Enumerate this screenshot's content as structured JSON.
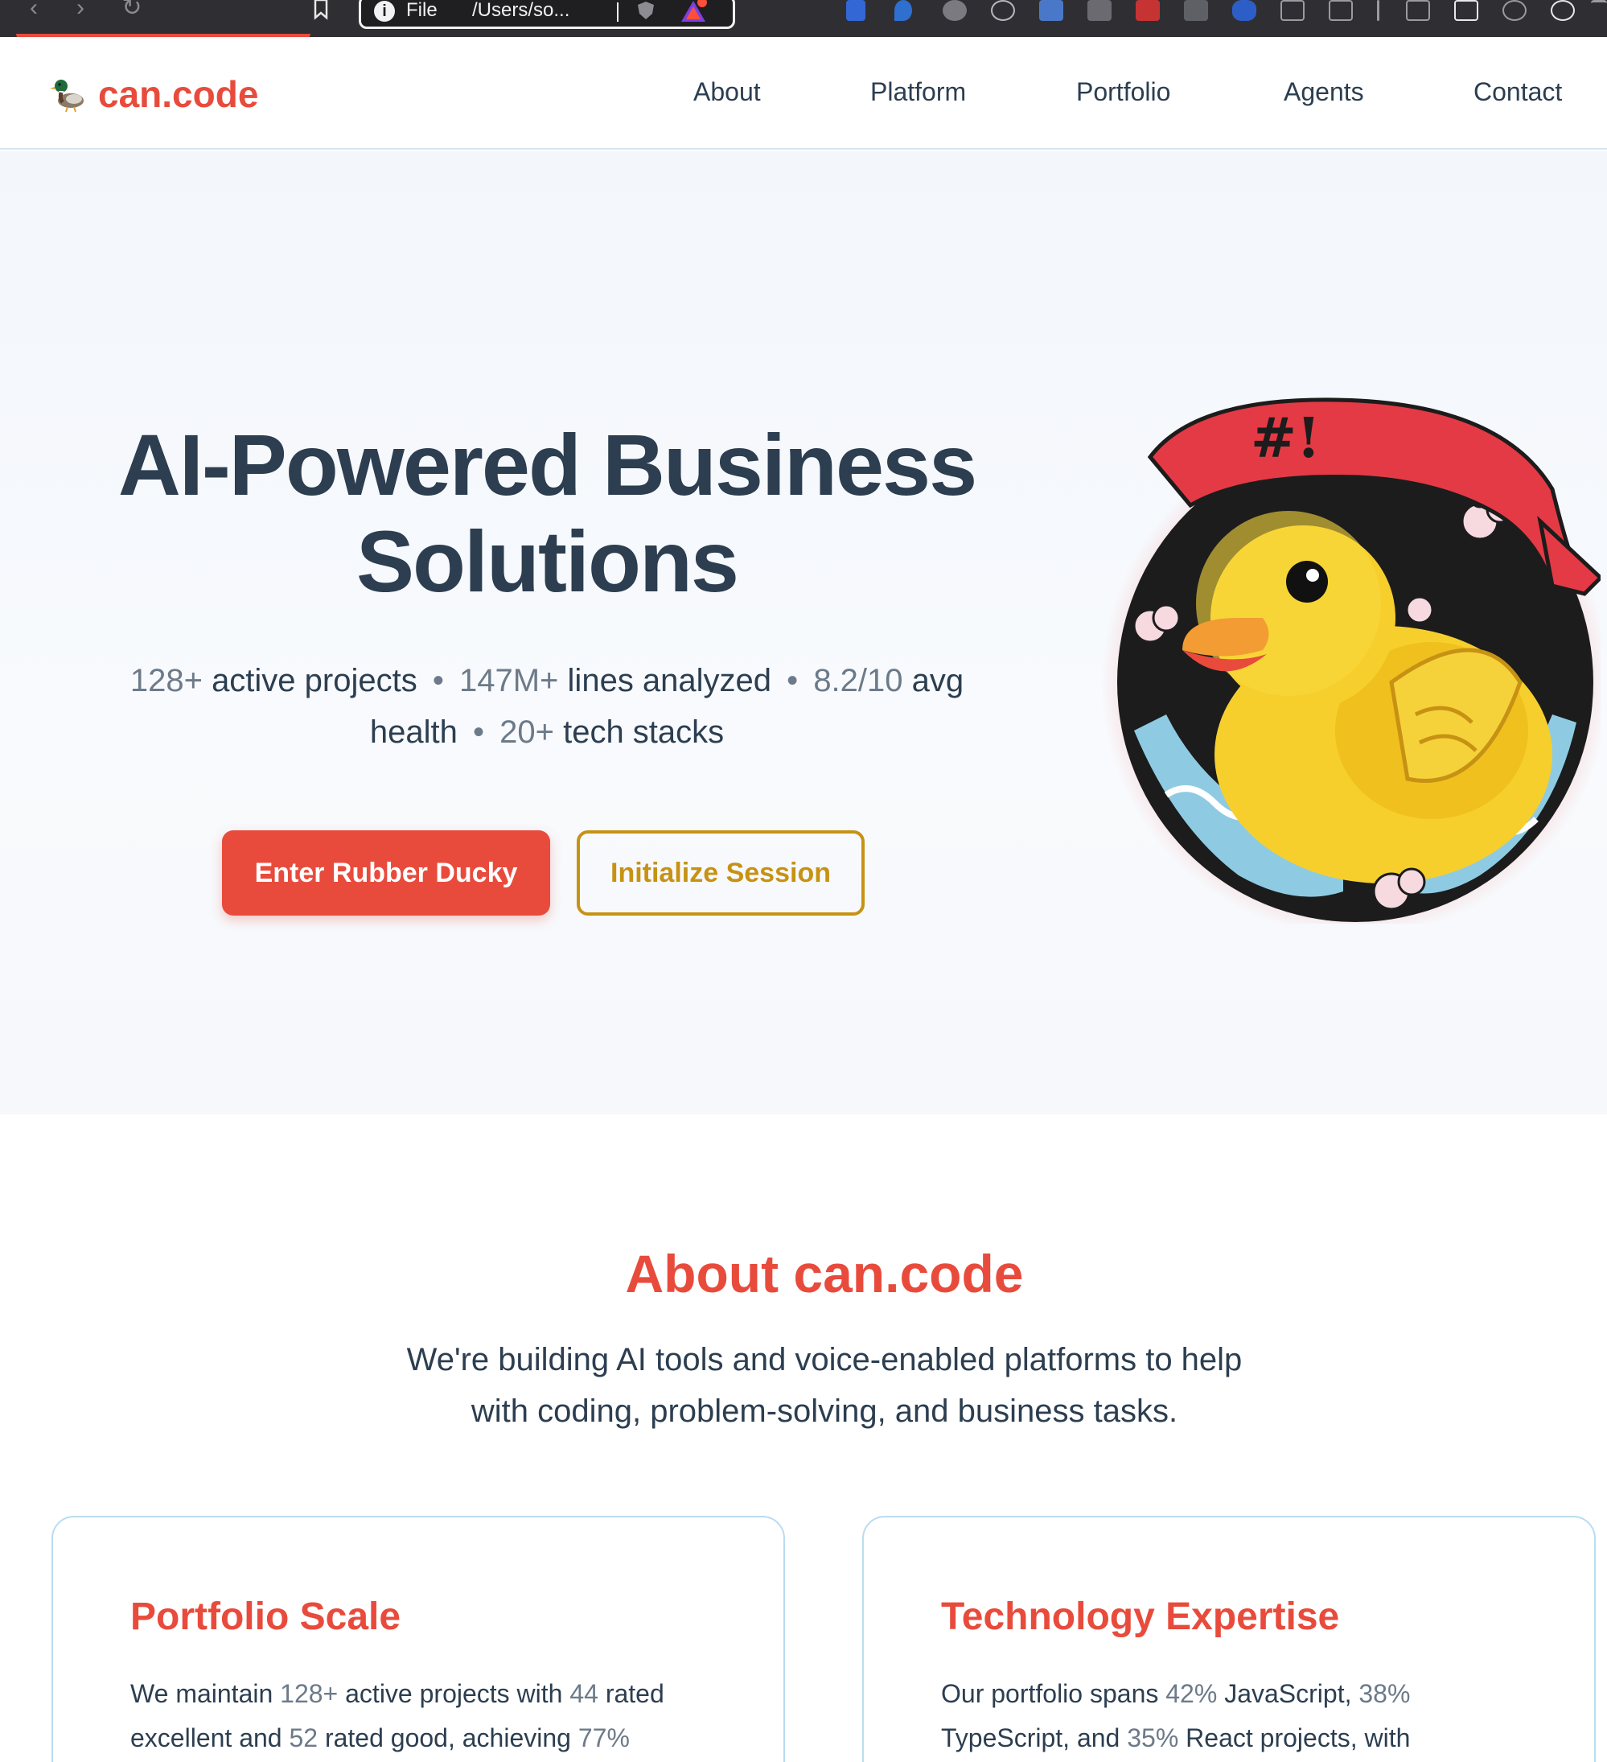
{
  "browser": {
    "url_scheme": "File",
    "url_path": "/Users/so..."
  },
  "brand": {
    "name": "can.code",
    "accent": "#e84b3c",
    "gold": "#c79214",
    "ink": "#2c3e50"
  },
  "nav": {
    "items": [
      "About",
      "Platform",
      "Portfolio",
      "Agents",
      "Contact"
    ]
  },
  "hero": {
    "title_line1": "AI-Powered Business",
    "title_line2": "Solutions",
    "stats": {
      "projects_num": "128+",
      "projects_label": "active projects",
      "lines_num": "147M+",
      "lines_label": "lines analyzed",
      "health_num": "8.2/10",
      "health_label_1": "avg",
      "health_label_2": "health",
      "stacks_num": "20+",
      "stacks_label": "tech stacks",
      "separator": "•"
    },
    "primary_button": "Enter Rubber Ducky",
    "secondary_button": "Initialize Session",
    "banner_text": "#!"
  },
  "about": {
    "title": "About can.code",
    "desc_line1": "We're building AI tools and voice-enabled platforms to help",
    "desc_line2": "with coding, problem-solving, and business tasks."
  },
  "cards": [
    {
      "title": "Portfolio Scale",
      "t1": "We maintain ",
      "n1": "128+",
      "t2": " active projects with ",
      "n2": "44",
      "t3": " rated",
      "t4": "excellent and ",
      "n3": "52",
      "t5": " rated good, achieving ",
      "n4": "77%"
    },
    {
      "title": "Technology Expertise",
      "t1": "Our portfolio spans ",
      "n1": "42%",
      "t2": " JavaScript, ",
      "n2": "38%",
      "t3": "TypeScript, and ",
      "n3": "35%",
      "t4": " React projects, with"
    }
  ]
}
